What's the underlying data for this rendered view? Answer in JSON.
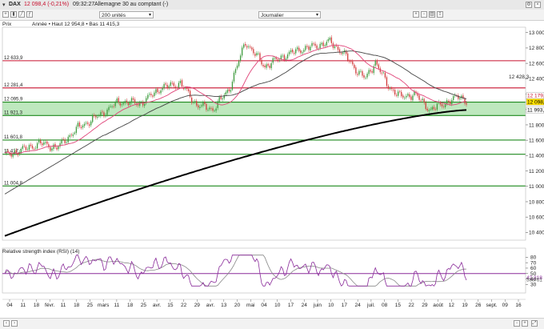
{
  "header": {
    "symbol": "DAX",
    "price": "12 098,4 (-0,21%)",
    "time": "09:32:27",
    "market": "Allemagne 30 au comptant (-)"
  },
  "toolbar": {
    "units": "200 unités",
    "period": "Journalier",
    "year_info": "Année • Haut 12 954,8 • Bas 11 415,3",
    "panel_label": "Prix"
  },
  "colors": {
    "resistance": "#c8102e",
    "support": "#1e8a1e",
    "zone": "#a8e0a8",
    "bull": "#3c9a3c",
    "bear": "#d23a3a",
    "ma20": "#e0457a",
    "ma50": "#444444",
    "ma200": "#000000",
    "rsi": "#8a2b9a",
    "rsi_ma": "#888888"
  },
  "levels": [
    {
      "label": "12 633,9",
      "value": 12634,
      "color": "resistance"
    },
    {
      "label": "12 281,4",
      "value": 12281,
      "color": "resistance"
    },
    {
      "label": "12 095,9",
      "value": 12096,
      "color": "support"
    },
    {
      "label": "11 921,3",
      "value": 11921,
      "color": "support"
    },
    {
      "label": "11 601,8",
      "value": 11602,
      "color": "support"
    },
    {
      "label": "11 417,1",
      "value": 11417,
      "color": "support"
    },
    {
      "label": "11 004,8",
      "value": 11005,
      "color": "support"
    }
  ],
  "badges": [
    {
      "label": "12 179,7",
      "value": 12180,
      "bg": "#ffffff",
      "fg": "#c8102e"
    },
    {
      "label": "12 098,4",
      "value": 12098,
      "bg": "#ffe000",
      "fg": "#000000"
    },
    {
      "label": "11 993,1",
      "value": 11993,
      "bg": "#ffffff",
      "fg": "#000000"
    }
  ],
  "badge_right": "12 428,3",
  "chart_data": {
    "type": "candlestick",
    "y_ticks": [
      13000,
      12800,
      12600,
      12400,
      12200,
      12000,
      11800,
      11600,
      11400,
      11200,
      11000,
      10800,
      10600,
      10400
    ],
    "ylim": [
      10300,
      13070
    ],
    "x_ticks": [
      "04",
      "11",
      "18",
      "févr.",
      "11",
      "18",
      "25",
      "mars",
      "11",
      "18",
      "25",
      "avr.",
      "15",
      "22",
      "29",
      "avr.",
      "13",
      "20",
      "mai",
      "04",
      "10",
      "17",
      "24",
      "juin",
      "10",
      "17",
      "24",
      "juil.",
      "08",
      "15",
      "22",
      "29",
      "août",
      "12",
      "19",
      "26",
      "sept.",
      "09",
      "16"
    ],
    "rsi": {
      "label": "Relative strength index (RSI) (14)",
      "y_ticks": [
        80,
        70,
        60,
        50,
        40,
        30
      ],
      "ylim": [
        26,
        85
      ],
      "reference": 50,
      "value_label": "42,318",
      "ma_label": "38,761"
    }
  }
}
